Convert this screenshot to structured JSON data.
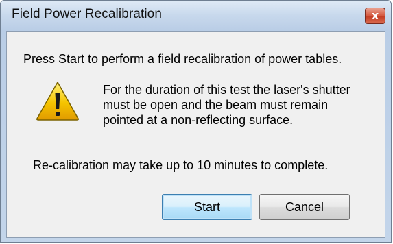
{
  "window": {
    "title": "Field Power Recalibration",
    "close_label": "x"
  },
  "dialog": {
    "intro": "Press Start to perform a field recalibration of power tables.",
    "detail_lines": [
      "For the duration of this test the laser's shutter",
      "must be open and the beam must remain",
      "pointed at a non-reflecting surface."
    ],
    "duration": "Re-calibration may take up to 10 minutes to complete.",
    "icon": "warning-icon"
  },
  "buttons": {
    "start_label": "Start",
    "cancel_label": "Cancel"
  },
  "colors": {
    "title_bar": "#c7d8ec",
    "client_bg": "#f0f0f0",
    "close_red": "#c23a21",
    "warning_yellow": "#f5c400",
    "default_button_border": "#3c7fb1"
  }
}
